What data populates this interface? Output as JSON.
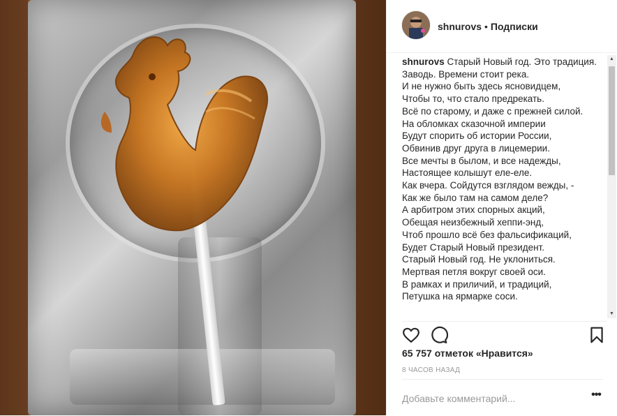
{
  "post": {
    "username": "shnurovs",
    "separator": "•",
    "follow_label": "Подписки",
    "caption": "Старый Новый год. Это традиция.\nЗаводь. Времени стоит река.\nИ не нужно быть здесь ясновидцем,\nЧтобы то, что стало предрекать.\nВсё по старому, и даже с прежней силой.\nНа обломках сказочной империи\nБудут спорить об истории России,\nОбвинив друг друга в лицемерии.\nВсе мечты в былом, и все надежды,\nНастоящее колышут еле-еле.\nКак вчера. Сойдутся взглядом вежды, -\nКак же было там на самом деле?\nА арбитром этих спорных акций,\nОбещая неизбежный хеппи-энд,\nЧтоб прошло всё без фальсификаций,\nБудет Старый Новый президент.\nСтарый Новый год. Не уклониться.\nМертвая петля вокруг своей оси.\nВ рамках и приличий, и традиций,\nПетушка на ярмарке соси.",
    "likes_text": "65 757 отметок «Нравится»",
    "time_text": "8 часов назад",
    "comment_placeholder": "Добавьте комментарий...",
    "more_label": "•••"
  },
  "icons": {
    "like": "heart-icon",
    "comment": "comment-bubble-icon",
    "save": "bookmark-icon",
    "more": "more-options-icon",
    "scroll_up": "scroll-up-arrow-icon",
    "scroll_down": "scroll-down-arrow-icon"
  },
  "colors": {
    "text": "#262626",
    "muted": "#999999",
    "divider": "#efefef",
    "candy": "#c8741c"
  }
}
